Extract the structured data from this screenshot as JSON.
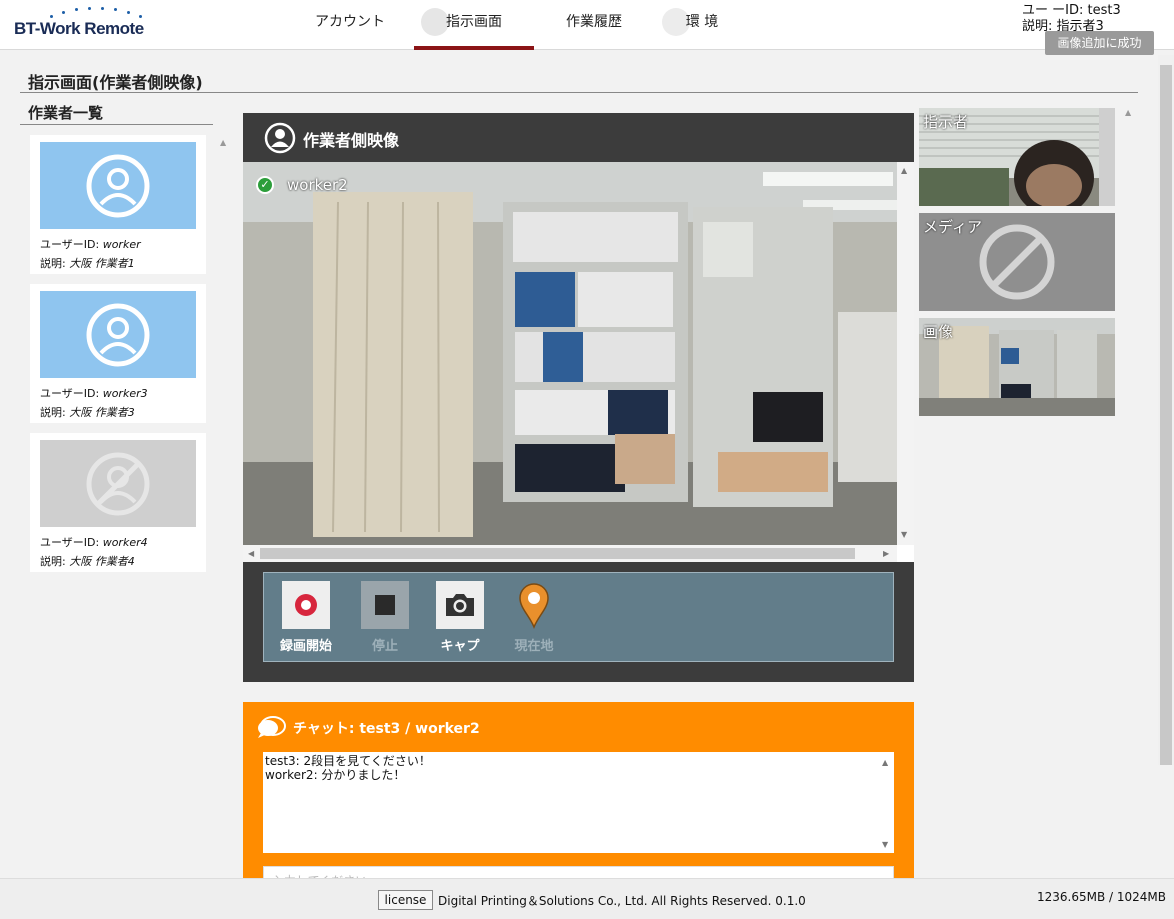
{
  "app": {
    "logo_text": "BT-Work Remote"
  },
  "nav": {
    "tabs": [
      {
        "label": "アカウント"
      },
      {
        "label": "指示画面"
      },
      {
        "label": "作業履歴"
      },
      {
        "label": "環 境"
      }
    ]
  },
  "user": {
    "id_line": "ユー ーID: test3",
    "desc_line": "説明: 指示者3"
  },
  "toast": "画像追加に成功",
  "page": {
    "title": "指示画面(作業者側映像)",
    "workers_heading": "作業者一覧"
  },
  "workers": [
    {
      "id_label": "ユーザーID:",
      "id": "worker",
      "desc_label": "説明:",
      "desc": "大阪 作業者1",
      "status": "online"
    },
    {
      "id_label": "ユーザーID:",
      "id": "worker3",
      "desc_label": "説明:",
      "desc": "大阪 作業者3",
      "status": "online"
    },
    {
      "id_label": "ユーザーID:",
      "id": "worker4",
      "desc_label": "説明:",
      "desc": "大阪 作業者4",
      "status": "offline"
    }
  ],
  "video": {
    "header": "作業者側映像",
    "worker_name": "worker2"
  },
  "controls": {
    "record": "録画開始",
    "stop": "停止",
    "capture": "キャプ",
    "location": "現在地"
  },
  "side_panels": {
    "instructor": "指示者",
    "media": "メディア",
    "image": "画像"
  },
  "chat": {
    "title": "チャット: test3 / worker2",
    "messages": [
      "test3: 2段目を見てください！",
      "worker2: 分かりました！"
    ],
    "input_placeholder": "入力してください"
  },
  "footer": {
    "license_label": "license",
    "copyright": "Digital Printing＆Solutions Co., Ltd. All Rights Reserved. 0.1.0",
    "memory": "1236.65MB / 1024MB"
  },
  "colors": {
    "accent_orange": "#ff8c00",
    "tab_underline": "#8b1416",
    "control_bar": "#627d8a",
    "online_thumb": "#8fc5ef"
  }
}
